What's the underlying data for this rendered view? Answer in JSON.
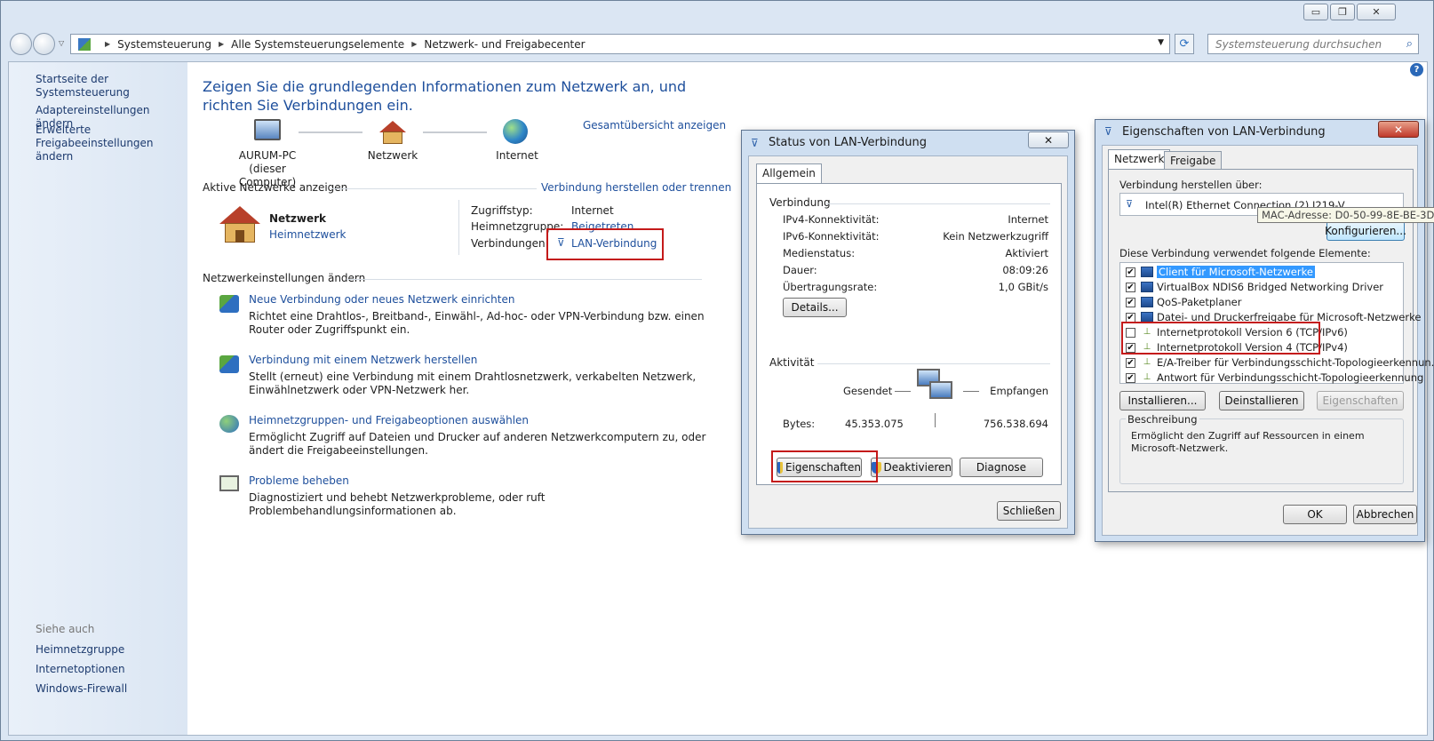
{
  "window": {
    "minimize": "▭",
    "restore": "❐",
    "close": "✕"
  },
  "address": {
    "crumbs": [
      "Systemsteuerung",
      "Alle Systemsteuerungselemente",
      "Netzwerk- und Freigabecenter"
    ],
    "search_placeholder": "Systemsteuerung durchsuchen"
  },
  "sidebar": {
    "items": [
      "Startseite der Systemsteuerung",
      "Adaptereinstellungen ändern",
      "Erweiterte Freigabeeinstellungen ändern"
    ],
    "see_also_title": "Siehe auch",
    "see_also": [
      "Heimnetzgruppe",
      "Internetoptionen",
      "Windows-Firewall"
    ]
  },
  "main": {
    "heading": "Zeigen Sie die grundlegenden Informationen zum Netzwerk an, und richten Sie Verbindungen ein.",
    "overview_link": "Gesamtübersicht anzeigen",
    "map": {
      "pc": "AURUM-PC",
      "pc_sub": "(dieser Computer)",
      "network": "Netzwerk",
      "internet": "Internet"
    },
    "active_title": "Aktive Netzwerke anzeigen",
    "connect_link": "Verbindung herstellen oder trennen",
    "active_net_name": "Netzwerk",
    "active_net_type": "Heimnetzwerk",
    "access_label": "Zugriffstyp:",
    "access_value": "Internet",
    "homegroup_label": "Heimnetzgruppe:",
    "homegroup_value": "Beigetreten",
    "connections_label": "Verbindungen:",
    "connections_value": "LAN-Verbindung",
    "settings_title": "Netzwerkeinstellungen ändern",
    "tasks": [
      {
        "title": "Neue Verbindung oder neues Netzwerk einrichten",
        "desc": "Richtet eine Drahtlos-, Breitband-, Einwähl-, Ad-hoc- oder VPN-Verbindung bzw. einen Router oder Zugriffspunkt ein."
      },
      {
        "title": "Verbindung mit einem Netzwerk herstellen",
        "desc": "Stellt (erneut) eine Verbindung mit einem Drahtlosnetzwerk, verkabelten Netzwerk, Einwählnetzwerk oder VPN-Netzwerk her."
      },
      {
        "title": "Heimnetzgruppen- und Freigabeoptionen auswählen",
        "desc": "Ermöglicht Zugriff auf Dateien und Drucker auf anderen Netzwerkcomputern zu, oder ändert die Freigabeeinstellungen."
      },
      {
        "title": "Probleme beheben",
        "desc": "Diagnostiziert und behebt Netzwerkprobleme, oder ruft Problembehandlungsinformationen ab."
      }
    ]
  },
  "status_dialog": {
    "title": "Status von LAN-Verbindung",
    "tab": "Allgemein",
    "connection_title": "Verbindung",
    "rows": [
      {
        "label": "IPv4-Konnektivität:",
        "value": "Internet"
      },
      {
        "label": "IPv6-Konnektivität:",
        "value": "Kein Netzwerkzugriff"
      },
      {
        "label": "Medienstatus:",
        "value": "Aktiviert"
      },
      {
        "label": "Dauer:",
        "value": "08:09:26"
      },
      {
        "label": "Übertragungsrate:",
        "value": "1,0 GBit/s"
      }
    ],
    "details_button": "Details...",
    "activity_title": "Aktivität",
    "sent_label": "Gesendet",
    "received_label": "Empfangen",
    "bytes_label": "Bytes:",
    "bytes_sent": "45.353.075",
    "bytes_received": "756.538.694",
    "properties_button": "Eigenschaften",
    "deactivate_button": "Deaktivieren",
    "diagnose_button": "Diagnose",
    "close_button": "Schließen"
  },
  "props_dialog": {
    "title": "Eigenschaften von LAN-Verbindung",
    "tabs": [
      "Netzwerk",
      "Freigabe"
    ],
    "connect_via_label": "Verbindung herstellen über:",
    "adapter": "Intel(R) Ethernet Connection (2) I219-V",
    "tooltip": "MAC-Adresse: D0-50-99-8E-BE-3D",
    "configure_button": "Konfigurieren...",
    "elements_label": "Diese Verbindung verwendet folgende Elemente:",
    "items": [
      {
        "label": "Client für Microsoft-Netzwerke",
        "checked": true,
        "kind": "net"
      },
      {
        "label": "VirtualBox NDIS6 Bridged Networking Driver",
        "checked": true,
        "kind": "net"
      },
      {
        "label": "QoS-Paketplaner",
        "checked": true,
        "kind": "net"
      },
      {
        "label": "Datei- und Druckerfreigabe für Microsoft-Netzwerke",
        "checked": true,
        "kind": "net"
      },
      {
        "label": "Internetprotokoll Version 6 (TCP/IPv6)",
        "checked": false,
        "kind": "proto"
      },
      {
        "label": "Internetprotokoll Version 4 (TCP/IPv4)",
        "checked": true,
        "kind": "proto"
      },
      {
        "label": "E/A-Treiber für Verbindungsschicht-Topologieerkennun...",
        "checked": true,
        "kind": "proto"
      },
      {
        "label": "Antwort für Verbindungsschicht-Topologieerkennung",
        "checked": true,
        "kind": "proto"
      }
    ],
    "install_button": "Installieren...",
    "uninstall_button": "Deinstallieren",
    "properties_button": "Eigenschaften",
    "description_title": "Beschreibung",
    "description": "Ermöglicht den Zugriff auf Ressourcen in einem Microsoft-Netzwerk.",
    "ok_button": "OK",
    "cancel_button": "Abbrechen"
  },
  "colors": {
    "link": "#1e4f9c",
    "highlight": "#3399ff",
    "annotation": "#c41a1a"
  }
}
